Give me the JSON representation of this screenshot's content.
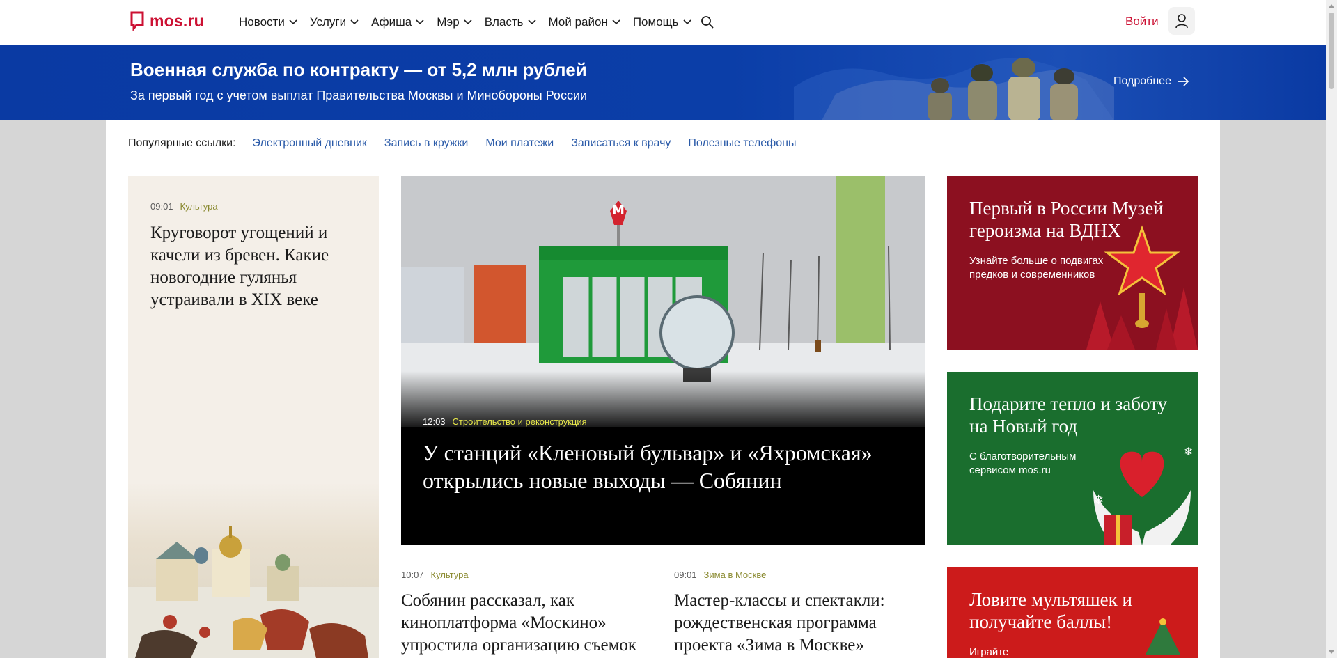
{
  "header": {
    "logo_text": "mos.ru",
    "nav": [
      "Новости",
      "Услуги",
      "Афиша",
      "Мэр",
      "Власть",
      "Мой район",
      "Помощь"
    ],
    "login_label": "Войти",
    "brand_color": "#cc1133"
  },
  "banner": {
    "title": "Военная служба по контракту — от 5,2 млн рублей",
    "subtitle": "За первый год с учетом выплат Правительства Москвы и Минобороны России",
    "more_label": "Подробнее",
    "background": "#0b3ea8"
  },
  "popular": {
    "label": "Популярные ссылки:",
    "links": [
      "Электронный дневник",
      "Запись в кружки",
      "Мои платежи",
      "Записаться к врачу",
      "Полезные телефоны"
    ]
  },
  "left_card": {
    "time": "09:01",
    "category": "Культура",
    "title": "Круговорот угощений и качели из бревен. Какие новогодние гулянья устраивали в XIX веке"
  },
  "main_card": {
    "time": "12:03",
    "category": "Строительство и реконструкция",
    "title": "У станций «Кленовый бульвар» и «Яхромская» открылись новые выходы — Собянин"
  },
  "news": [
    {
      "time": "10:07",
      "category": "Культура",
      "title": "Собянин рассказал, как киноплатформа «Москино» упростила организацию съемок"
    },
    {
      "time": "09:01",
      "category": "Зима в Москве",
      "title": "Мастер-классы и спектакли: рождественская программа проекта «Зима в Москве»"
    }
  ],
  "promos": [
    {
      "title": "Первый в России Музей героизма на ВДНХ",
      "subtitle": "Узнайте больше о подвигах предков и современников",
      "background": "#8c1020"
    },
    {
      "title": "Подарите тепло и заботу на Новый год",
      "subtitle": "С благотворительным сервисом mos.ru",
      "background": "#1a6e2e"
    },
    {
      "title": "Ловите мультяшек и получайте баллы!",
      "subtitle": "Играйте",
      "background": "#cc1b1b"
    }
  ]
}
